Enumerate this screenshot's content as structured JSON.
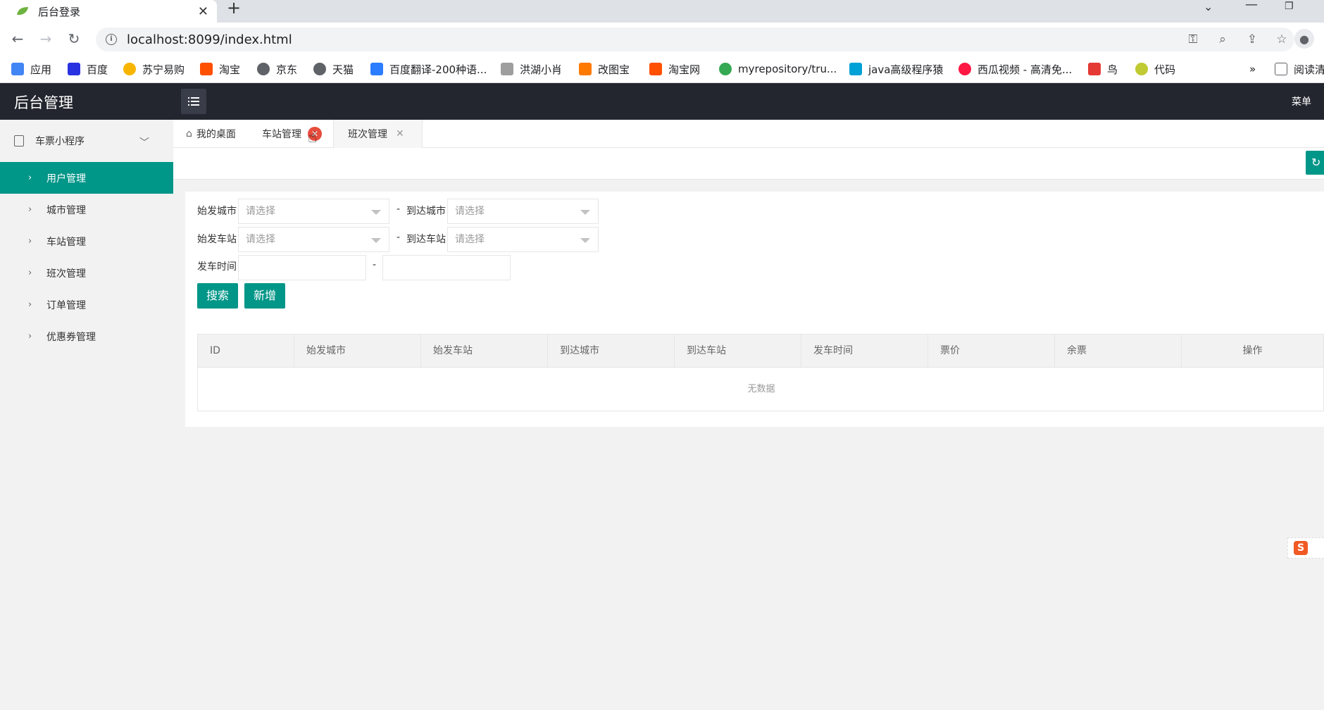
{
  "browser": {
    "tab_title": "后台登录",
    "tab_close": "✕",
    "new_tab": "+",
    "url": "localhost:8099/index.html",
    "bookmarks": [
      {
        "label": "应用",
        "icon": "apps-grid-icon",
        "color": "#4285f4"
      },
      {
        "label": "百度",
        "icon": "baidu-icon",
        "color": "#2932e1"
      },
      {
        "label": "苏宁易购",
        "icon": "suning-icon",
        "color": "#f7b500"
      },
      {
        "label": "淘宝",
        "icon": "taobao-icon",
        "color": "#ff5000"
      },
      {
        "label": "京东",
        "icon": "globe-icon",
        "color": "#5f6368"
      },
      {
        "label": "天猫",
        "icon": "globe-icon",
        "color": "#5f6368"
      },
      {
        "label": "百度翻译-200种语...",
        "icon": "translate-icon",
        "color": "#2b7cff"
      },
      {
        "label": "洪湖小肖",
        "icon": "feather-icon",
        "color": "#5f6368"
      },
      {
        "label": "改图宝",
        "icon": "gaitubao-icon",
        "color": "#ff7a00"
      },
      {
        "label": "淘宝网",
        "icon": "taobao-icon",
        "color": "#ff5000"
      },
      {
        "label": "myrepository/tru...",
        "icon": "chrome-icon",
        "color": "#34a853"
      },
      {
        "label": "java高级程序猿",
        "icon": "bilibili-icon",
        "color": "#00a1d6"
      },
      {
        "label": "西瓜视频 - 高清免...",
        "icon": "xigua-icon",
        "color": "#ff1744"
      },
      {
        "label": "鸟",
        "icon": "bird-icon",
        "color": "#e53935"
      },
      {
        "label": "代码",
        "icon": "code-icon",
        "color": "#c0ca33"
      }
    ],
    "more_bookmarks": "»",
    "reading_list": "阅读清"
  },
  "app": {
    "logo": "后台管理",
    "header_menu": "菜单",
    "sidebar": {
      "group": "车票小程序",
      "items": [
        {
          "label": "用户管理",
          "active": true
        },
        {
          "label": "城市管理",
          "active": false
        },
        {
          "label": "车站管理",
          "active": false
        },
        {
          "label": "班次管理",
          "active": false
        },
        {
          "label": "订单管理",
          "active": false
        },
        {
          "label": "优惠券管理",
          "active": false
        }
      ]
    },
    "tabs": [
      {
        "label": "我的桌面"
      },
      {
        "label": "车站管理"
      },
      {
        "label": "班次管理"
      }
    ],
    "accent_color": "#009688"
  },
  "form": {
    "start_city_label": "始发城市",
    "end_city_label": "到达城市",
    "start_station_label": "始发车站",
    "end_station_label": "到达车站",
    "depart_time_label": "发车时间",
    "placeholder": "请选择",
    "dash": "-",
    "search_button": "搜索",
    "add_button": "新增"
  },
  "table": {
    "columns": [
      "ID",
      "始发城市",
      "始发车站",
      "到达城市",
      "到达车站",
      "发车时间",
      "票价",
      "余票",
      "操作"
    ],
    "empty_text": "无数据"
  }
}
